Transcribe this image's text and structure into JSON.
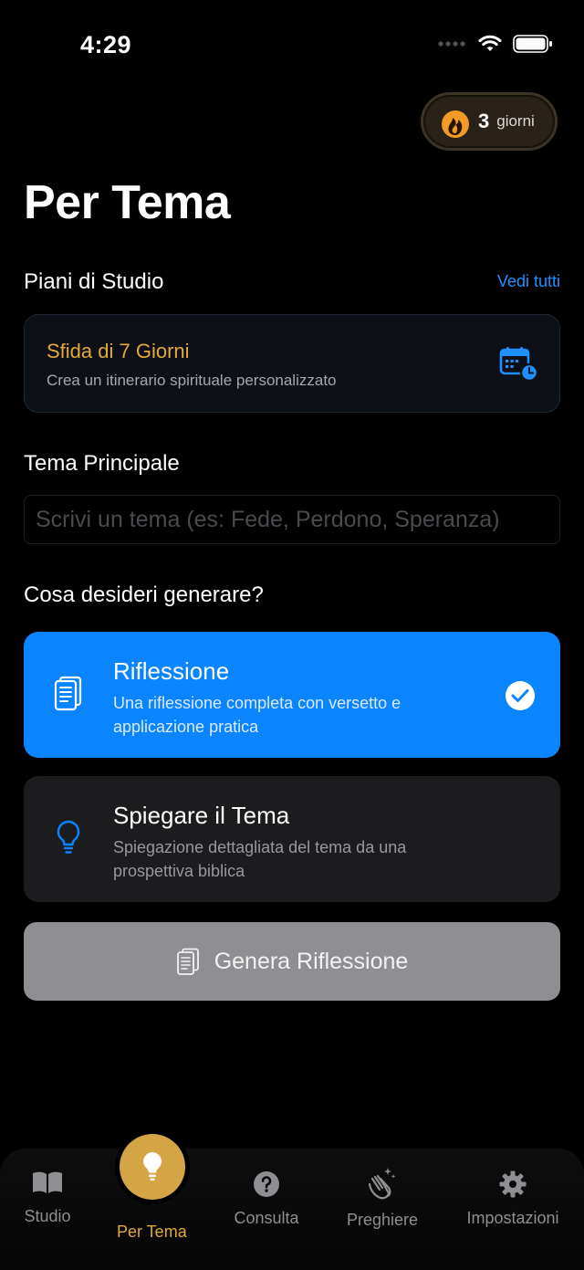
{
  "status_bar": {
    "time": "4:29"
  },
  "streak": {
    "count": "3",
    "unit": "giorni"
  },
  "page_title": "Per Tema",
  "plans": {
    "heading": "Piani di Studio",
    "see_all": "Vedi tutti",
    "card": {
      "title": "Sfida di 7 Giorni",
      "subtitle": "Crea un itinerario spirituale personalizzato",
      "icon": "calendar-clock-icon"
    }
  },
  "theme": {
    "heading": "Tema Principale",
    "placeholder": "Scrivi un tema (es: Fede, Perdono, Speranza)",
    "value": ""
  },
  "generate": {
    "heading": "Cosa desideri generare?",
    "options": [
      {
        "title": "Riflessione",
        "description": "Una riflessione completa con versetto e applicazione pratica",
        "icon": "document-icon",
        "selected": true
      },
      {
        "title": "Spiegare il Tema",
        "description": "Spiegazione dettagliata del tema da una prospettiva biblica",
        "icon": "lightbulb-icon",
        "selected": false
      }
    ],
    "button_label": "Genera Riflessione"
  },
  "tabbar": {
    "items": [
      {
        "label": "Studio",
        "icon": "book-icon"
      },
      {
        "label": "Per Tema",
        "icon": "lightbulb-icon",
        "active": true
      },
      {
        "label": "Consulta",
        "icon": "question-icon"
      },
      {
        "label": "Preghiere",
        "icon": "praying-hands-icon"
      },
      {
        "label": "Impostazioni",
        "icon": "gear-icon"
      }
    ]
  },
  "colors": {
    "accent_blue": "#0a84ff",
    "accent_gold": "#e3a93a",
    "disabled_button": "#8e8e93"
  }
}
